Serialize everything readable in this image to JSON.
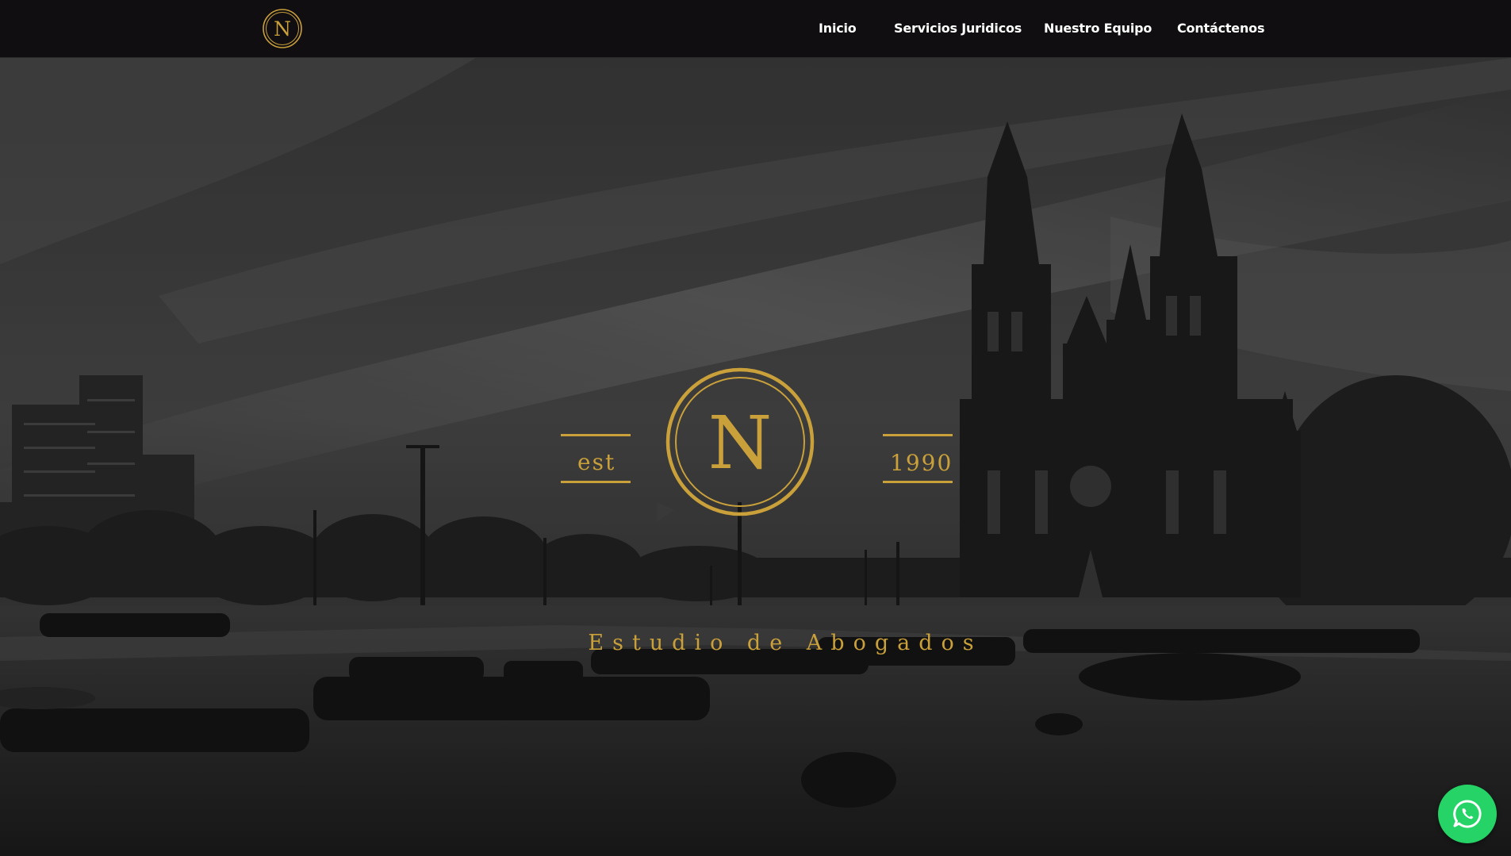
{
  "header": {
    "logo_letter": "N",
    "nav": [
      {
        "label": "Inicio"
      },
      {
        "label": "Servicios Juridicos"
      },
      {
        "label": "Nuestro Equipo"
      },
      {
        "label": "Contáctenos"
      }
    ]
  },
  "hero": {
    "emblem_letter": "N",
    "est_label": "est",
    "year": "1990",
    "tagline": "Estudio de Abogados"
  },
  "colors": {
    "gold": "#c9a03a",
    "header_bg": "#100e10",
    "whatsapp_green": "#25d366"
  },
  "icons": {
    "floating_button": "whatsapp-icon"
  }
}
